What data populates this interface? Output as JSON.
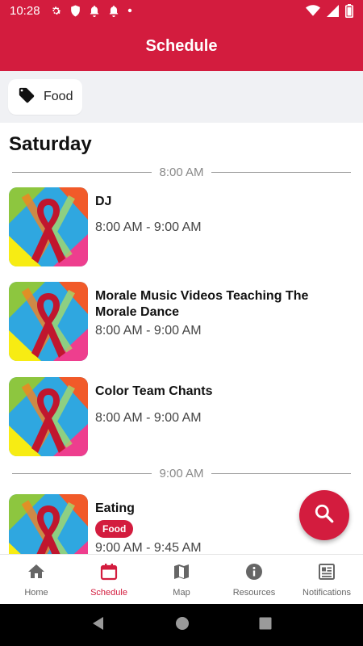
{
  "status_bar": {
    "time": "10:28"
  },
  "app_bar": {
    "title": "Schedule"
  },
  "filter": {
    "chip_label": "Food"
  },
  "schedule": {
    "day": "Saturday",
    "groups": [
      {
        "time_label": "8:00 AM"
      },
      {
        "time_label": "9:00 AM"
      }
    ],
    "events": [
      {
        "name": "DJ",
        "time": "8:00 AM - 9:00 AM"
      },
      {
        "name": "Morale Music Videos Teaching The Morale Dance",
        "time": "8:00 AM - 9:00 AM"
      },
      {
        "name": "Color Team Chants",
        "time": "8:00 AM - 9:00 AM"
      },
      {
        "name": "Eating",
        "tag": "Food",
        "time": "9:00 AM - 9:45 AM"
      }
    ]
  },
  "bottom_nav": {
    "items": [
      {
        "label": "Home",
        "icon": "home-icon"
      },
      {
        "label": "Schedule",
        "icon": "calendar-icon"
      },
      {
        "label": "Map",
        "icon": "map-icon"
      },
      {
        "label": "Resources",
        "icon": "info-icon"
      },
      {
        "label": "Notifications",
        "icon": "newspaper-icon"
      }
    ],
    "active_index": 1
  },
  "colors": {
    "accent": "#d31c3e",
    "filter_bg": "#f0f1f4",
    "divider": "#a0a0a0"
  }
}
